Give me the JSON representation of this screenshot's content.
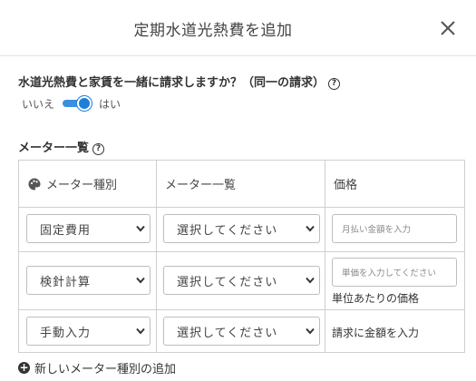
{
  "dialog": {
    "title": "定期水道光熱費を追加",
    "close_icon": "close-icon"
  },
  "combine": {
    "question": "水道光熱費と家賃を一緒に請求しますか？（同一の請求）",
    "help": "?",
    "no_label": "いいえ",
    "yes_label": "はい",
    "toggle_on": true,
    "accent": "#1f7fd8"
  },
  "meters": {
    "heading": "メーター一覧",
    "help": "?",
    "columns": [
      "メーター種別",
      "メーター一覧",
      "価格"
    ],
    "column_icon": "palette-icon",
    "rows": [
      {
        "type": "固定費用",
        "meter": "選択してください",
        "price_placeholder": "月払い金額を入力",
        "note": ""
      },
      {
        "type": "検針計算",
        "meter": "選択してください",
        "price_placeholder": "単価を入力してください",
        "note": "単位あたりの価格"
      },
      {
        "type": "手動入力",
        "meter": "選択してください",
        "price_placeholder": "",
        "note": "請求に金額を入力"
      }
    ],
    "add_label": "新しいメーター種別の追加"
  }
}
